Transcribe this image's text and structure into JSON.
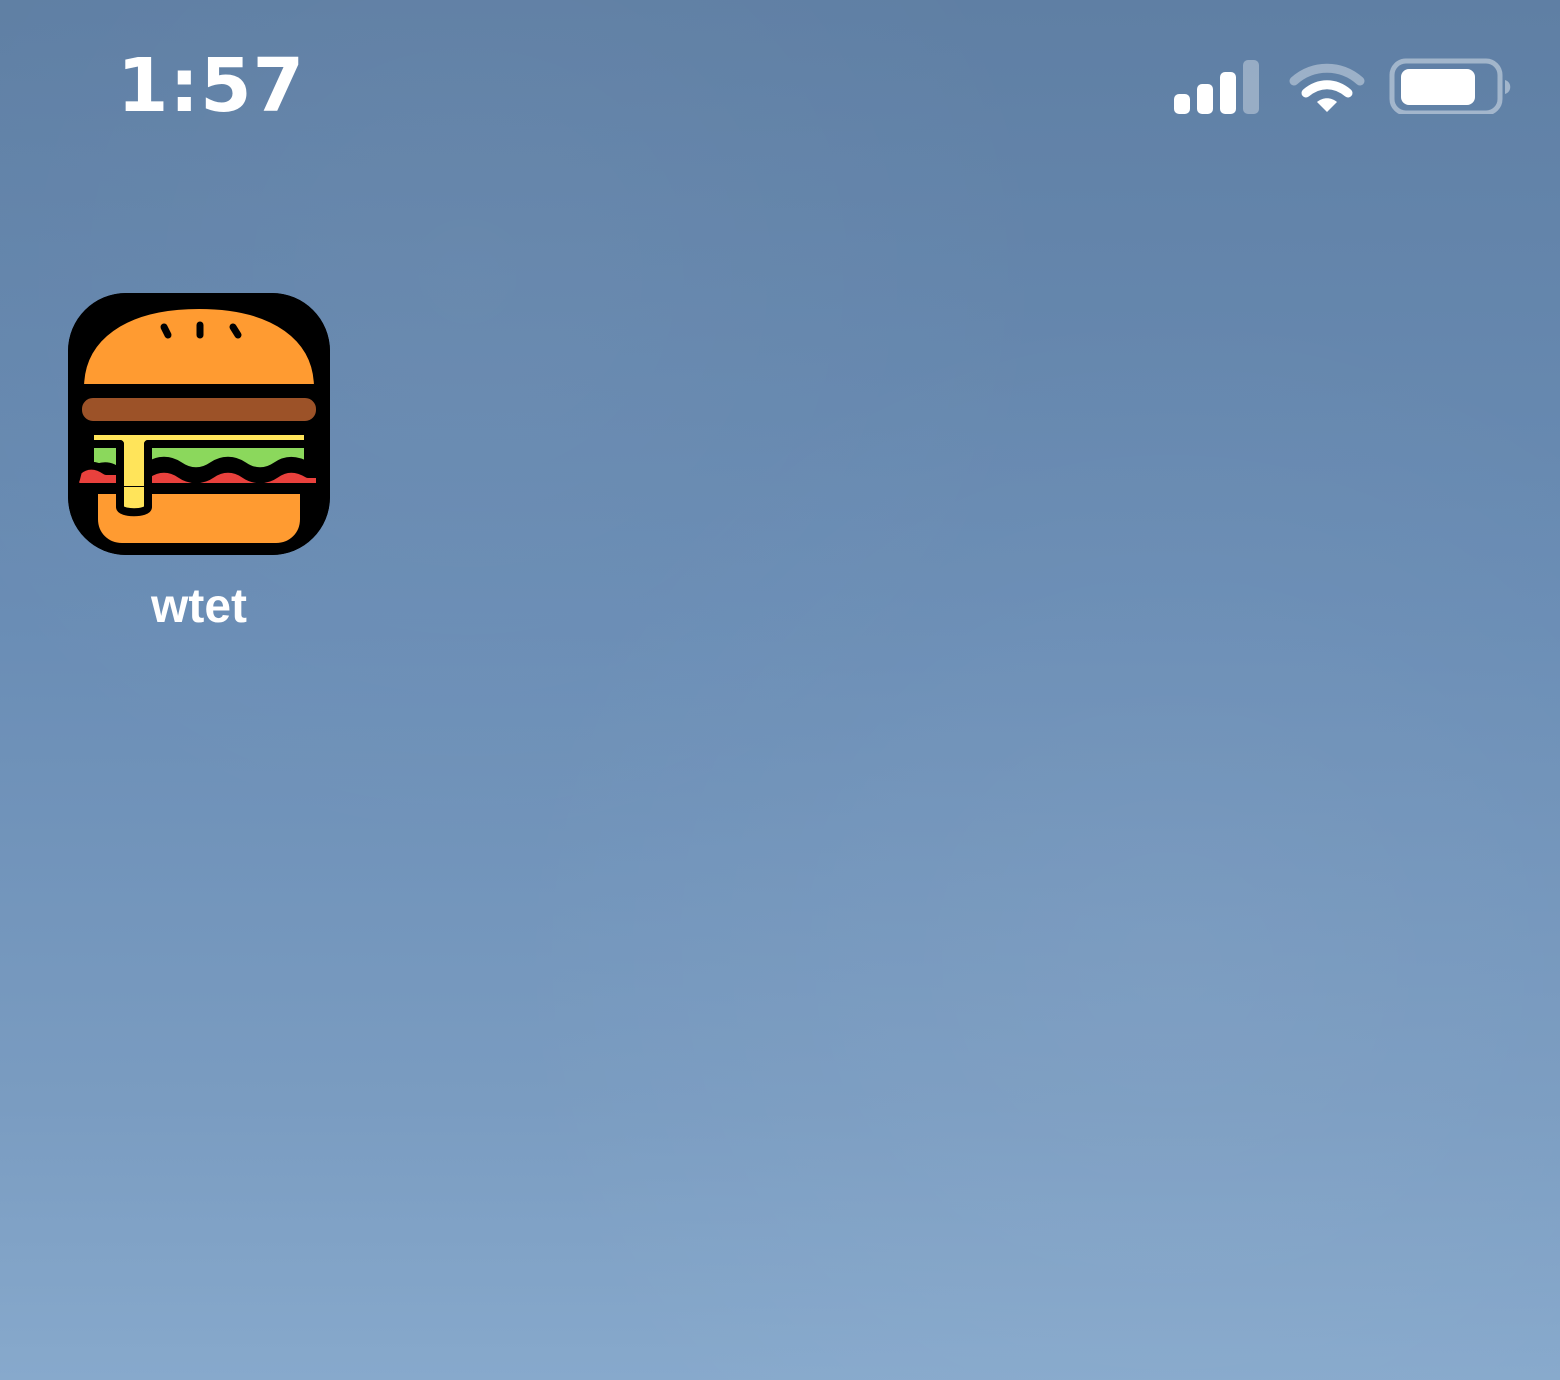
{
  "status_bar": {
    "time": "1:57",
    "signal_icon": "signal-strength-icon",
    "wifi_icon": "wifi-icon",
    "battery_icon": "battery-icon",
    "signal_bars_filled": 3,
    "signal_bars_total": 4
  },
  "home_screen": {
    "apps": [
      {
        "label": "wtet",
        "icon": "hamburger-icon"
      }
    ]
  },
  "colors": {
    "wallpaper_top": "#5f7fa4",
    "wallpaper_bottom": "#87a9cc",
    "status_text": "#ffffff",
    "icon_background": "#000000",
    "bun": "#ff9b31",
    "patty": "#9c5228",
    "cheese": "#ffe45a",
    "lettuce": "#8bd85c",
    "tomato": "#e9413d"
  }
}
